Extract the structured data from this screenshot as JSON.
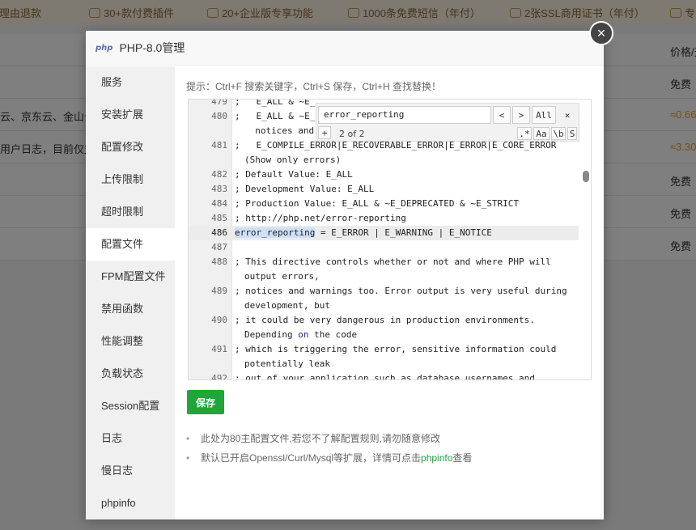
{
  "background": {
    "topbar": [
      "无理由退款",
      "30+款付费插件",
      "20+企业版专享功能",
      "1000条免费短信（年付）",
      "2张SSL商用证书（年付）",
      "专"
    ],
    "column_header": "价格/天",
    "rows": [
      {
        "left": "",
        "right": "免费",
        "orange": false
      },
      {
        "left": "云、京东云、金山云",
        "right": "≈0.66",
        "orange": true
      },
      {
        "left": "用户日志，目前仅支",
        "right": "≈3.30",
        "orange": true
      },
      {
        "left": "",
        "right": "免费",
        "orange": false
      },
      {
        "left": "",
        "right": "免费",
        "orange": false
      },
      {
        "left": "",
        "right": "免费",
        "orange": false
      }
    ]
  },
  "dialog": {
    "logo_text": "php",
    "title": "PHP-8.0管理",
    "close_label": "×",
    "sidebar": [
      {
        "label": "服务"
      },
      {
        "label": "安装扩展"
      },
      {
        "label": "配置修改"
      },
      {
        "label": "上传限制"
      },
      {
        "label": "超时限制"
      },
      {
        "label": "配置文件",
        "active": true
      },
      {
        "label": "FPM配置文件"
      },
      {
        "label": "禁用函数"
      },
      {
        "label": "性能调整"
      },
      {
        "label": "负载状态"
      },
      {
        "label": "Session配置"
      },
      {
        "label": "日志"
      },
      {
        "label": "慢日志"
      },
      {
        "label": "phpinfo"
      }
    ],
    "tip": "提示：Ctrl+F 搜索关键字，Ctrl+S 保存，Ctrl+H 查找替换！",
    "editor": {
      "lines": [
        {
          "n": "479",
          "text": ";   E_ALL & ~E_"
        },
        {
          "n": "480",
          "text": ";   E_ALL & ~E_",
          "cont": "  notices and c"
        },
        {
          "n": "481",
          "text": ";   E_COMPILE_ERROR|E_RECOVERABLE_ERROR|E_ERROR|E_CORE_ERROR",
          "cont": "(Show only errors)"
        },
        {
          "n": "482",
          "text": "; Default Value: E_ALL"
        },
        {
          "n": "483",
          "text": "; Development Value: E_ALL"
        },
        {
          "n": "484",
          "text": "; Production Value: E_ALL & ~E_DEPRECATED & ~E_STRICT"
        },
        {
          "n": "485",
          "text": "; http://php.net/error-reporting"
        },
        {
          "n": "486",
          "text_match": "error_reporting",
          "text_rest": " = E_ERROR | E_WARNING | E_NOTICE"
        },
        {
          "n": "487",
          "text": ""
        },
        {
          "n": "488",
          "text": "; This directive controls whether or not and where PHP will",
          "cont": "output errors,"
        },
        {
          "n": "489",
          "text": "; notices and warnings too. Error output is very useful during",
          "cont": "development, but"
        },
        {
          "n": "490",
          "text": "; it could be very dangerous in production environments.",
          "cont_pre": "Depending ",
          "cont_kw": "on",
          "cont_post": " the code"
        },
        {
          "n": "491",
          "text": "; which is triggering the error, sensitive information could",
          "cont": "potentially leak"
        },
        {
          "n": "492",
          "text": "; out of your application such as database usernames and"
        }
      ],
      "search": {
        "query": "error_reporting",
        "prev": "<",
        "next": ">",
        "all": "All",
        "close": "✕",
        "plus": "+",
        "count": "2 of 2",
        "opt_regex": ".*",
        "opt_case": "Aa",
        "opt_word": "\\b",
        "opt_sel": "S"
      }
    },
    "save_label": "保存",
    "notes": {
      "n1": "此处为80主配置文件,若您不了解配置规则,请勿随意修改",
      "n2_pre": "默认已开启Openssl/Curl/Mysql等扩展，详情可点击",
      "n2_link": "phpinfo",
      "n2_post": "查看"
    }
  }
}
